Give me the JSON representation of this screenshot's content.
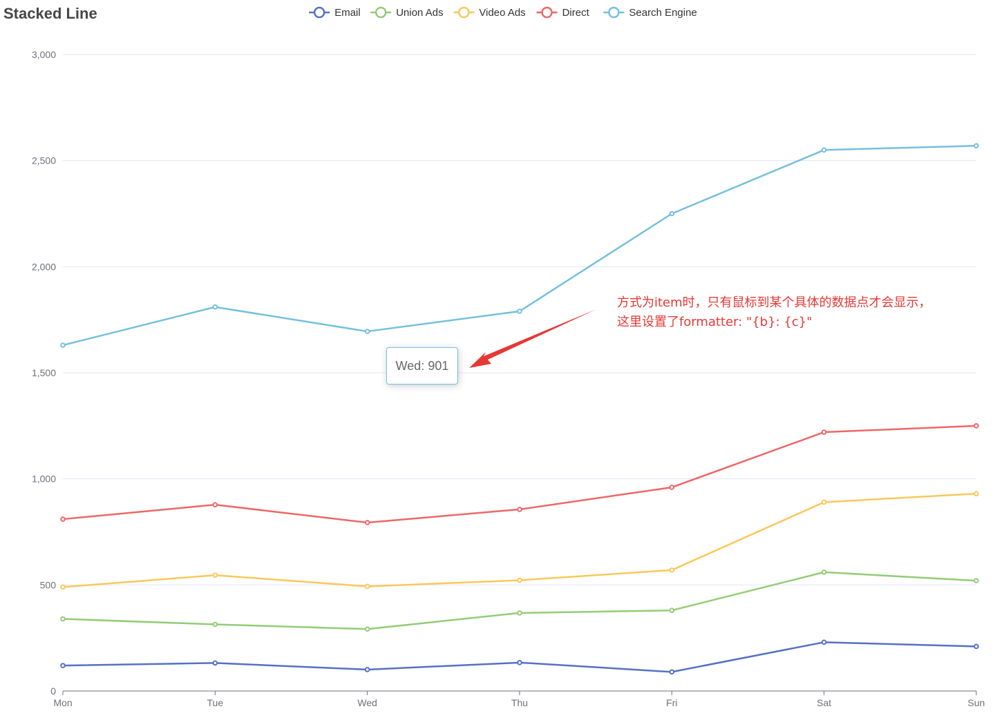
{
  "chart_data": {
    "type": "line",
    "title": "Stacked Line",
    "stacked": true,
    "categories": [
      "Mon",
      "Tue",
      "Wed",
      "Thu",
      "Fri",
      "Sat",
      "Sun"
    ],
    "ylim": [
      0,
      3000
    ],
    "yticks": [
      0,
      500,
      1000,
      1500,
      2000,
      2500,
      3000
    ],
    "ytick_labels": [
      "0",
      "500",
      "1,000",
      "1,500",
      "2,000",
      "2,500",
      "3,000"
    ],
    "grid": true,
    "legend_position": "top-center",
    "series": [
      {
        "name": "Email",
        "color": "#5470c6",
        "values": [
          120,
          132,
          101,
          134,
          90,
          230,
          210
        ]
      },
      {
        "name": "Union Ads",
        "color": "#91cc75",
        "values": [
          220,
          182,
          191,
          234,
          290,
          330,
          310
        ]
      },
      {
        "name": "Video Ads",
        "color": "#fac858",
        "values": [
          150,
          232,
          201,
          154,
          190,
          330,
          410
        ]
      },
      {
        "name": "Direct",
        "color": "#ee6666",
        "values": [
          320,
          332,
          301,
          334,
          390,
          330,
          320
        ]
      },
      {
        "name": "Search Engine",
        "color": "#73c0de",
        "values": [
          820,
          932,
          901,
          934,
          1290,
          1330,
          1320
        ]
      }
    ],
    "tooltip": {
      "text": "Wed: 901",
      "border_color": "#73c0de"
    },
    "annotation": {
      "lines": [
        "方式为item时，只有鼠标到某个具体的数据点才会显示，",
        "这里设置了formatter: \"{b}: {c}\""
      ],
      "color": "#e53935"
    }
  }
}
